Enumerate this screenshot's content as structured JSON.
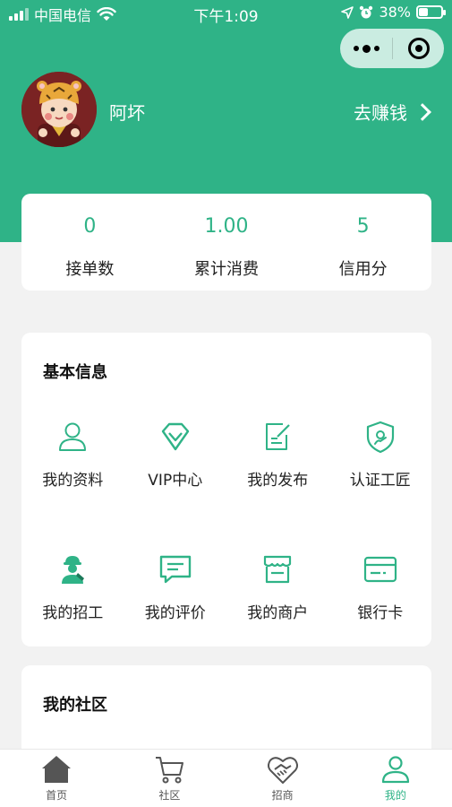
{
  "status_bar": {
    "carrier": "中国电信",
    "time": "下午1:09",
    "battery_percent": "38%",
    "battery_level": 0.38
  },
  "profile": {
    "username": "阿坏",
    "earn_link": "去赚钱"
  },
  "stats": [
    {
      "value": "0",
      "label": "接单数"
    },
    {
      "value": "1.00",
      "label": "累计消费"
    },
    {
      "value": "5",
      "label": "信用分"
    }
  ],
  "basic_info": {
    "title": "基本信息",
    "items": [
      {
        "label": "我的资料",
        "icon": "user-icon"
      },
      {
        "label": "VIP中心",
        "icon": "diamond-icon"
      },
      {
        "label": "我的发布",
        "icon": "edit-document-icon"
      },
      {
        "label": "认证工匠",
        "icon": "shield-check-icon"
      },
      {
        "label": "我的招工",
        "icon": "worker-icon"
      },
      {
        "label": "我的评价",
        "icon": "comment-icon"
      },
      {
        "label": "我的商户",
        "icon": "store-icon"
      },
      {
        "label": "银行卡",
        "icon": "bank-card-icon"
      }
    ]
  },
  "community": {
    "title": "我的社区"
  },
  "tabbar": [
    {
      "label": "首页",
      "icon": "home-icon",
      "active": false
    },
    {
      "label": "社区",
      "icon": "cart-icon",
      "active": false
    },
    {
      "label": "招商",
      "icon": "handshake-icon",
      "active": false
    },
    {
      "label": "我的",
      "icon": "user-icon",
      "active": true
    }
  ],
  "colors": {
    "primary": "#2fb387",
    "background": "#f2f2f2",
    "card": "#ffffff"
  }
}
